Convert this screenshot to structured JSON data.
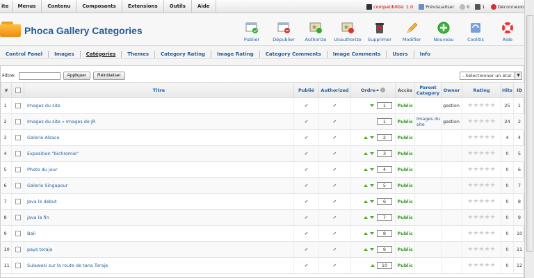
{
  "menu": {
    "items": [
      "ite",
      "Menus",
      "Contenu",
      "Composants",
      "Extensions",
      "Outils",
      "Aide"
    ],
    "right": {
      "compat": "compatibilité: 1.0",
      "preview": "Prévisualiser",
      "messages": "0",
      "users": "1",
      "logout": "Déconnexion"
    }
  },
  "header": {
    "title": "Phoca Gallery Categories",
    "toolbar": [
      "Publier",
      "Dépublier",
      "Authorize",
      "Unauthorize",
      "Supprimer",
      "Modifier",
      "Nouveau",
      "Coolitis",
      "Aide"
    ]
  },
  "tabs": [
    "Control Panel",
    "Images",
    "Catégories",
    "Themes",
    "Category Rating",
    "Image Rating",
    "Category Comments",
    "Image Comments",
    "Users",
    "Info"
  ],
  "filter": {
    "label": "Filtre:",
    "value": "",
    "apply": "Appliquer",
    "reset": "Réinitialiser",
    "state_select": "- Sélectionner un état -"
  },
  "table": {
    "headers": {
      "num": "#",
      "title": "Titre",
      "published": "Publié",
      "authorized": "Authorized",
      "order": "Ordre",
      "access": "Accès",
      "parent": "Parent Category",
      "owner": "Owner",
      "rating": "Rating",
      "hits": "Hits",
      "id": "ID"
    },
    "rows": [
      {
        "num": "1",
        "title": "Images du site",
        "order": "1",
        "access": "Public",
        "parent": "",
        "owner": "gestion",
        "hits": "25",
        "id": "1",
        "up": false,
        "down": true
      },
      {
        "num": "2",
        "title": "Images du site » Images de JR",
        "order": "1",
        "access": "Public",
        "parent": "Images du site",
        "owner": "gestion",
        "hits": "24",
        "id": "2",
        "up": false,
        "down": false
      },
      {
        "num": "3",
        "title": "Galerie Alsace",
        "order": "2",
        "access": "Public",
        "parent": "",
        "owner": "",
        "hits": "4",
        "id": "4",
        "up": true,
        "down": true
      },
      {
        "num": "4",
        "title": "Exposition \"bichromie\"",
        "order": "3",
        "access": "Public",
        "parent": "",
        "owner": "",
        "hits": "0",
        "id": "5",
        "up": true,
        "down": true
      },
      {
        "num": "5",
        "title": "Photo du jour",
        "order": "4",
        "access": "Public",
        "parent": "",
        "owner": "",
        "hits": "0",
        "id": "6",
        "up": true,
        "down": true
      },
      {
        "num": "6",
        "title": "Galerie Singapour",
        "order": "5",
        "access": "Public",
        "parent": "",
        "owner": "",
        "hits": "0",
        "id": "7",
        "up": true,
        "down": true
      },
      {
        "num": "7",
        "title": "Java le debut",
        "order": "6",
        "access": "Public",
        "parent": "",
        "owner": "",
        "hits": "0",
        "id": "8",
        "up": true,
        "down": true
      },
      {
        "num": "8",
        "title": "java la fin",
        "order": "7",
        "access": "Public",
        "parent": "",
        "owner": "",
        "hits": "0",
        "id": "9",
        "up": true,
        "down": true
      },
      {
        "num": "9",
        "title": "Bali",
        "order": "8",
        "access": "Public",
        "parent": "",
        "owner": "",
        "hits": "0",
        "id": "10",
        "up": true,
        "down": true
      },
      {
        "num": "10",
        "title": "pays toraja",
        "order": "9",
        "access": "Public",
        "parent": "",
        "owner": "",
        "hits": "0",
        "id": "11",
        "up": true,
        "down": true
      },
      {
        "num": "11",
        "title": "Sulawesi sur la route de tana Toraja",
        "order": "10",
        "access": "Public",
        "parent": "",
        "owner": "",
        "hits": "0",
        "id": "12",
        "up": true,
        "down": false
      }
    ]
  },
  "colors": {
    "link": "#1f5b9c",
    "publish_green": "#2e9a1f",
    "arrow_green": "#5aa82a"
  }
}
